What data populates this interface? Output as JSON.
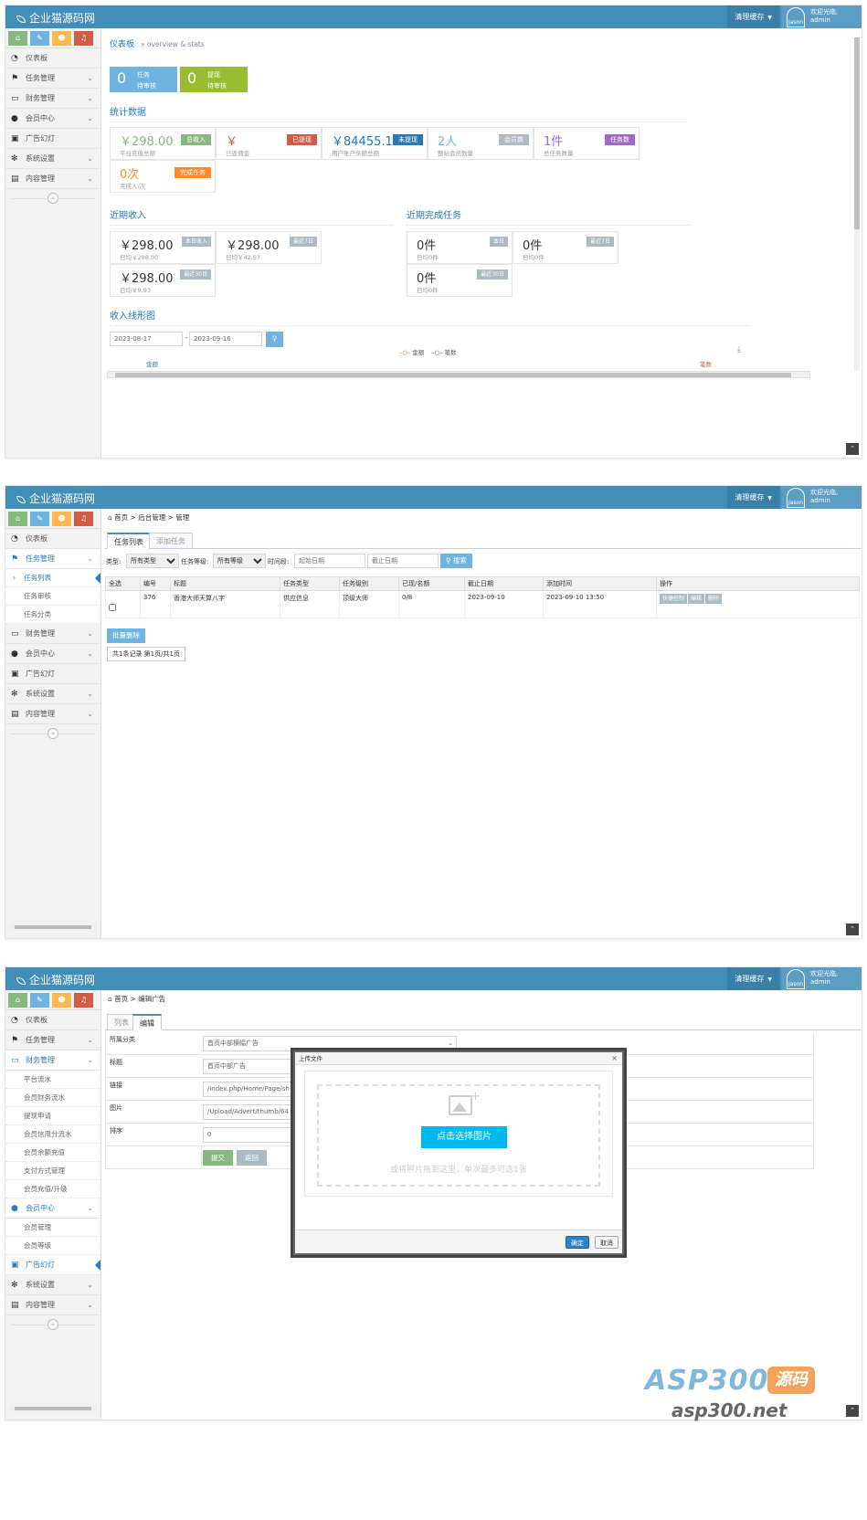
{
  "common": {
    "logo": "企业猫源码网",
    "clear_cache": "清理缓存",
    "avatar_name": "Jason",
    "welcome_line1": "欢迎光临,",
    "welcome_line2": "admin"
  },
  "menu": {
    "dashboard": "仪表板",
    "task": "任务管理",
    "finance": "财务管理",
    "member": "会员中心",
    "ad": "广告幻灯",
    "system": "系统设置",
    "content": "内容管理"
  },
  "panel1": {
    "bread_title": "仪表板",
    "bread_sub": "» overview & stats",
    "top_boxes": [
      {
        "num": "0",
        "line1": "任务",
        "line2": "待审核",
        "color": "#6fb3e0"
      },
      {
        "num": "0",
        "line1": "提现",
        "line2": "待审核",
        "color": "#9abc32"
      }
    ],
    "stats_title": "统计数据",
    "stats": [
      {
        "value": "￥298.00",
        "label": "平台充值总额",
        "badge": "总收入",
        "color": "#87b87f"
      },
      {
        "value": "￥",
        "label": "已返佣金",
        "badge": "已提现",
        "color": "#d15b47"
      },
      {
        "value": "￥84455.1",
        "label": "用户账户余额总额",
        "badge": "未提现",
        "color": "#2679b5"
      },
      {
        "value": "2人",
        "label": "整站会员数量",
        "badge": "会员数",
        "color": "#abbac3"
      },
      {
        "value": "1件",
        "label": "总任务数量",
        "badge": "任务数",
        "color": "#a069c3"
      },
      {
        "value": "0次",
        "label": "完成人/次",
        "badge": "完成任务",
        "color": "#ff892a"
      }
    ],
    "income_title": "近期收入",
    "income": [
      {
        "value": "￥298.00",
        "label": "日均￥298.00",
        "badge": "本日收入"
      },
      {
        "value": "￥298.00",
        "label": "日均￥42.57",
        "badge": "最近7日"
      },
      {
        "value": "￥298.00",
        "label": "日均￥9.93",
        "badge": "最近30日"
      }
    ],
    "task_title": "近期完成任务",
    "tasks": [
      {
        "value": "0件",
        "label": "日均0件",
        "badge": "本日"
      },
      {
        "value": "0件",
        "label": "日均0件",
        "badge": "最近7日"
      },
      {
        "value": "0件",
        "label": "日均0件",
        "badge": "最近30日"
      }
    ],
    "chart_title": "收入线形图",
    "date_from": "2023-08-17",
    "date_to": "2023-09-16",
    "legend_amount": "金额",
    "legend_count": "笔数",
    "axis_left": "金额",
    "axis_right": "笔数"
  },
  "panel2": {
    "bread": "首页 > 后台管理 > 管理",
    "sub_list": "任务列表",
    "sub_audit": "任务审核",
    "sub_cat": "任务分类",
    "tab_list": "任务列表",
    "tab_add": "添加任务",
    "filter_type_label": "类型:",
    "filter_type_value": "所有类型",
    "filter_level_label": "任务等级:",
    "filter_level_value": "所有等级",
    "filter_time_label": "时间段:",
    "start_placeholder": "起始日期",
    "end_placeholder": "截止日期",
    "search_btn": "搜索",
    "columns": [
      "全选",
      "编号",
      "标题",
      "任务类型",
      "任务级别",
      "已现/名额",
      "截止日期",
      "添加时间",
      "操作"
    ],
    "row": {
      "id": "376",
      "title": "香港大师天算八字",
      "type": "供应信息",
      "level": "顶级大师",
      "quota": "0/8",
      "deadline": "2023-09-10",
      "added": "2023-09-10 13:50"
    },
    "ops": [
      "快捷控制",
      "编辑",
      "删除"
    ],
    "batch_delete": "批量删除",
    "pagination": "共1条记录 第1页/共1页"
  },
  "panel3": {
    "bread": "首页 > 编辑广告",
    "tab_list": "列表",
    "tab_edit": "编辑",
    "sub_items": [
      "平台流水",
      "会员财务流水",
      "提现申请",
      "会员信用分流水",
      "会员余额充值",
      "支付方式管理",
      "会员充值/升级"
    ],
    "member_sub": [
      "会员管理",
      "会员等级"
    ],
    "fields": [
      {
        "label": "所属分类",
        "value": "首页中部横幅广告"
      },
      {
        "label": "标题",
        "value": "首页中部广告"
      },
      {
        "label": "链接",
        "value": "/index.php/Home/Page/sh"
      },
      {
        "label": "图片",
        "value": "/Upload/Advert/thumb/64"
      },
      {
        "label": "排序",
        "value": "0"
      }
    ],
    "submit": "提交",
    "back": "返回",
    "modal_title": "上传文件",
    "choose_img": "点击选择图片",
    "drop_hint": "或将照片拖到这里，单次最多可选1张",
    "ok": "确定",
    "cancel": "取消"
  },
  "watermark": {
    "brand": "ASP300",
    "tag": "源码",
    "url": "asp300.net"
  }
}
